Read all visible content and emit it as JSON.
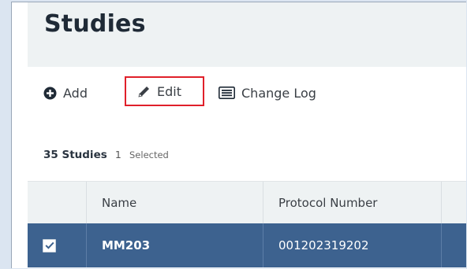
{
  "page": {
    "title": "Studies"
  },
  "toolbar": {
    "add_label": "Add",
    "edit_label": "Edit",
    "change_log_label": "Change Log"
  },
  "summary": {
    "count": "35 Studies",
    "selected_count": "1",
    "selected_label": "Selected"
  },
  "table": {
    "columns": [
      "Name",
      "Protocol Number"
    ],
    "rows": [
      {
        "selected": true,
        "name": "MM203",
        "protocol_number": "001202319202"
      }
    ]
  },
  "colors": {
    "selected_row": "#3d628f",
    "highlight_border": "#e0202a",
    "header_bg": "#eef2f3"
  }
}
